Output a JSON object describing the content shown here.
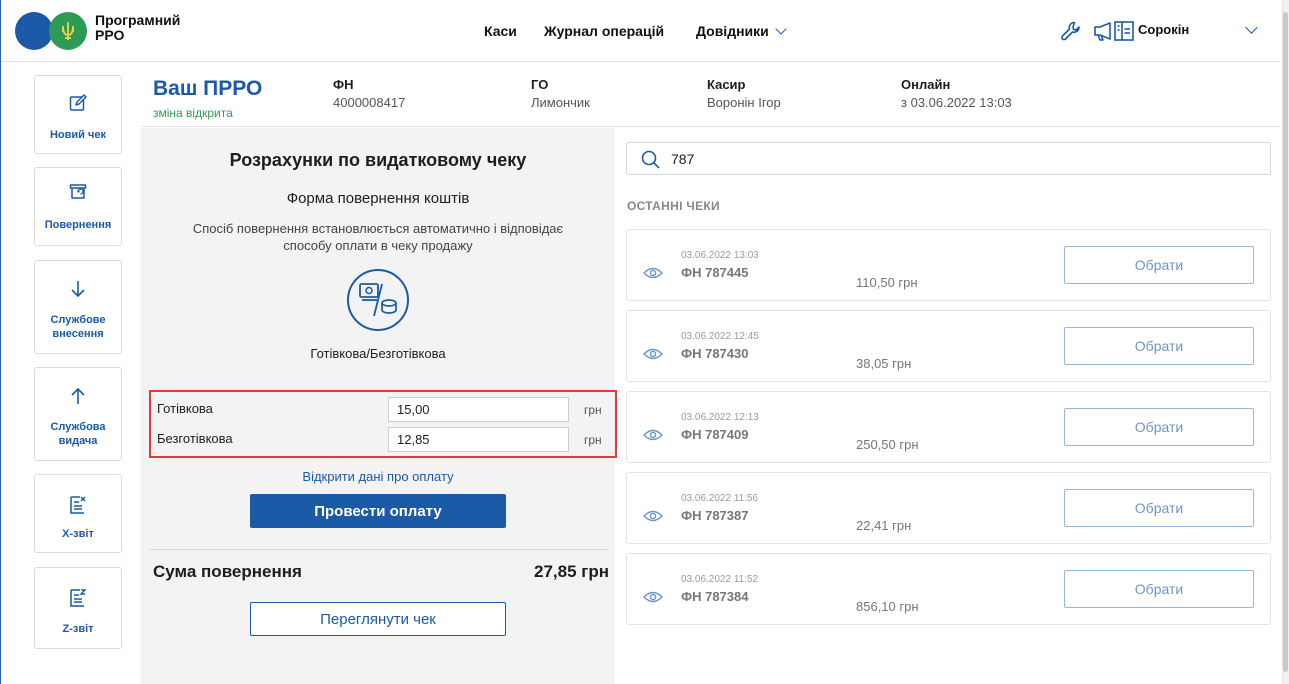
{
  "app": {
    "title_line1": "Програмний",
    "title_line2": "РРО",
    "colors": {
      "primary": "#1b5aa6",
      "success": "#2e9b54",
      "highlight": "#e23b3b"
    }
  },
  "nav": {
    "kasy": "Каси",
    "journal": "Журнал операцій",
    "dovidnyky": "Довідники"
  },
  "header_icons": [
    "wrench-icon",
    "megaphone-icon",
    "building-icon"
  ],
  "user": {
    "name": "Сорокін"
  },
  "sidebar": {
    "items": [
      {
        "label": "Новий чек",
        "icon": "edit-icon"
      },
      {
        "label": "Повернення",
        "icon": "return-icon"
      },
      {
        "label": "Службове внесення",
        "icon": "arrow-down-icon"
      },
      {
        "label": "Службова видача",
        "icon": "arrow-up-icon"
      },
      {
        "label": "Х-звіт",
        "icon": "x-report-icon"
      },
      {
        "label": "Z-звіт",
        "icon": "z-report-icon"
      }
    ]
  },
  "info": {
    "brand": "Ваш ПРРО",
    "status": "зміна відкрита",
    "fn_label": "ФН",
    "fn_value": "4000008417",
    "go_label": "ГО",
    "go_value": "Лимончик",
    "cashier_label": "Касир",
    "cashier_value": "Воронін Ігор",
    "online_label": "Онлайн",
    "online_value": "з 03.06.2022 13:03"
  },
  "refund": {
    "title": "Розрахунки по видатковому чеку",
    "subtitle": "Форма повернення коштів",
    "description_line1": "Спосіб повернення встановлюється автоматично і відповідає",
    "description_line2": "способу оплати в чеку продажу",
    "payment_type": "Готівкова/Безготівкова",
    "cash_label": "Готівкова",
    "cash_value": "15,00",
    "noncash_label": "Безготівкова",
    "noncash_value": "12,85",
    "currency": "грн",
    "open_payment_link": "Відкрити дані про оплату",
    "pay_button": "Провести оплату",
    "sum_label": "Сума повернення",
    "sum_value": "27,85 грн",
    "view_receipt_button": "Переглянути чек"
  },
  "search": {
    "value": "787"
  },
  "recent": {
    "title": "ОСТАННІ ЧЕКИ",
    "select_label": "Обрати",
    "items": [
      {
        "time": "03.06.2022 13:03",
        "fn": "ФН 787445",
        "sum": "110,50 грн"
      },
      {
        "time": "03.06.2022 12:45",
        "fn": "ФН 787430",
        "sum": "38,05 грн"
      },
      {
        "time": "03.06.2022 12:13",
        "fn": "ФН 787409",
        "sum": "250,50 грн"
      },
      {
        "time": "03.06.2022 11:56",
        "fn": "ФН 787387",
        "sum": "22,41 грн"
      },
      {
        "time": "03.06.2022 11:52",
        "fn": "ФН 787384",
        "sum": "856,10 грн"
      }
    ]
  }
}
